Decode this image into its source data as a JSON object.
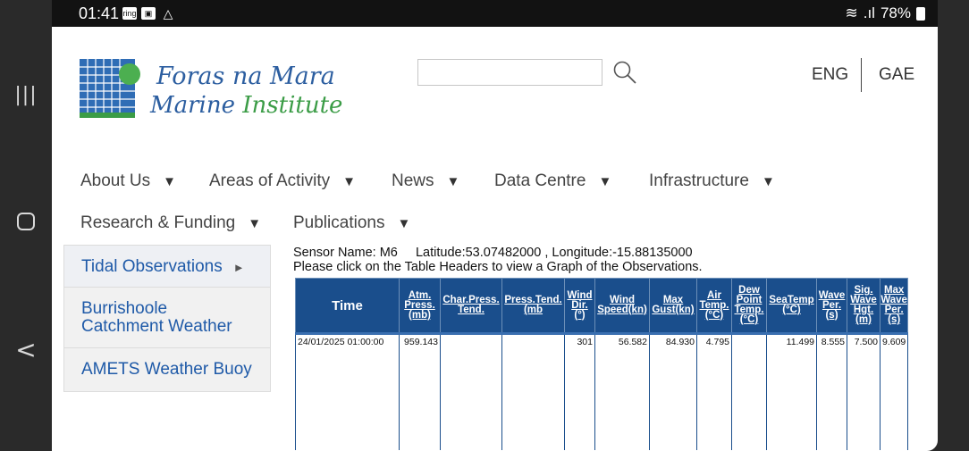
{
  "statusbar": {
    "time": "01:41",
    "icons": [
      "ring-icon",
      "notification-icon",
      "alert-icon"
    ],
    "battery": "78%"
  },
  "header": {
    "brand_line1": "Foras na Mara",
    "brand_line2_a": "Marine",
    "brand_line2_b": "Institute",
    "search": {
      "value": "",
      "placeholder": ""
    },
    "lang_eng": "ENG",
    "lang_gae": "GAE"
  },
  "nav": {
    "items": [
      {
        "label": "About Us"
      },
      {
        "label": "Areas of Activity"
      },
      {
        "label": "News"
      },
      {
        "label": "Data Centre"
      },
      {
        "label": "Infrastructure"
      },
      {
        "label": "Research & Funding"
      },
      {
        "label": "Publications"
      }
    ],
    "arrow": "▼"
  },
  "sidebar": {
    "items": [
      {
        "label": "Tidal Observations",
        "arrow": "►"
      },
      {
        "label_a": "Burrishoole",
        "label_b": "Catchment Weather"
      },
      {
        "label": "AMETS Weather Buoy"
      }
    ]
  },
  "sensor": {
    "line1": "Sensor Name: M6     Latitude:53.07482000 , Longitude:-15.88135000",
    "line2": "Please click on the Table Headers to view a Graph of the Observations."
  },
  "table": {
    "headers": [
      [
        "Time"
      ],
      [
        "Atm.",
        "Press.",
        "(mb)"
      ],
      [
        "Char.Press.",
        "Tend."
      ],
      [
        "Press.Tend.",
        "(mb"
      ],
      [
        "Wind",
        "Dir.",
        "(°)"
      ],
      [
        "Wind",
        "Speed(kn)"
      ],
      [
        "Max",
        "Gust(kn)"
      ],
      [
        "Air",
        "Temp.",
        "(°C)"
      ],
      [
        "Dew",
        "Point",
        "Temp.",
        "(°C)"
      ],
      [
        "SeaTemp",
        "(°C)"
      ],
      [
        "Wave",
        "Per.",
        "(s)"
      ],
      [
        "Sig.",
        "Wave",
        "Hgt.",
        "(m)"
      ],
      [
        "Max",
        "Wave",
        "Per.",
        "(s)"
      ]
    ],
    "rows": [
      [
        "24/01/2025 01:00:00",
        "959.143",
        "",
        "",
        "301",
        "56.582",
        "84.930",
        "4.795",
        "",
        "11.499",
        "8.555",
        "7.500",
        "9.609"
      ]
    ]
  }
}
